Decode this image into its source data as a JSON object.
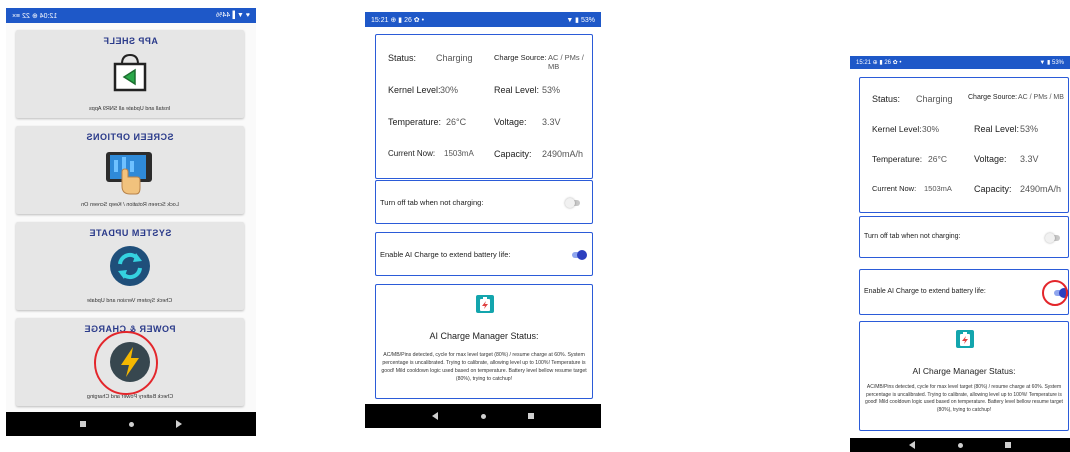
{
  "phone1": {
    "status_left": "♥ ▼ ▌44%",
    "status_right": "12:04 ⊕ 22 ≡×",
    "menu": [
      {
        "title": "APP SHELF",
        "subtitle": "Install and Update all SNR9 Apps",
        "icon": "app-shelf-bag-icon"
      },
      {
        "title": "SCREEN OPTIONS",
        "subtitle": "Lock Screen Rotation / Keep Screen On",
        "icon": "tablet-touch-icon"
      },
      {
        "title": "SYSTEM UPDATE",
        "subtitle": "Check System Version and Update",
        "icon": "refresh-circle-icon"
      },
      {
        "title": "POWER & CHARGE",
        "subtitle": "Check Battery Power and Charging",
        "icon": "lightning-circle-icon"
      }
    ]
  },
  "phone2": {
    "status_left": "15:21 ⊕ ▮ 26 ✿ •",
    "status_right": "▼ ▮ 53%",
    "stats": {
      "status_label": "Status:",
      "status_value": "Charging",
      "source_label": "Charge Source:",
      "source_value": "AC / PMs / MB",
      "kernel_label": "Kernel Level:",
      "kernel_value": "30%",
      "real_label": "Real Level:",
      "real_value": "53%",
      "temp_label": "Temperature:",
      "temp_value": "26°C",
      "voltage_label": "Voltage:",
      "voltage_value": "3.3V",
      "current_label": "Current Now:",
      "current_value": "1503mA",
      "capacity_label": "Capacity:",
      "capacity_value": "2490mA/h"
    },
    "turn_off_label": "Turn off tab when not charging:",
    "ai_label": "Enable AI Charge to extend battery life:",
    "manager_title": "AI Charge Manager Status:",
    "manager_desc": "AC/MB/Pins detected, cycle for max level target (80%) / resume charge at 60%. System percentage is uncalibrated. Trying to calibrate, allowing level up to 100%! Temperature is good! Mild cooldown logic used based on temperature. Battery level bellow resume target (80%), trying to catchup!"
  },
  "phone3": {
    "status_left": "15:21 ⊕ ▮ 26 ✿ •",
    "status_right": "▼ ▮ 53%",
    "stats": {
      "status_label": "Status:",
      "status_value": "Charging",
      "source_label": "Charge Source:",
      "source_value": "AC / PMs / MB",
      "kernel_label": "Kernel Level:",
      "kernel_value": "30%",
      "real_label": "Real Level:",
      "real_value": "53%",
      "temp_label": "Temperature:",
      "temp_value": "26°C",
      "voltage_label": "Voltage:",
      "voltage_value": "3.3V",
      "current_label": "Current Now:",
      "current_value": "1503mA",
      "capacity_label": "Capacity:",
      "capacity_value": "2490mA/h"
    },
    "turn_off_label": "Turn off tab when not charging:",
    "ai_label": "Enable AI Charge to extend battery life:",
    "manager_title": "AI Charge Manager Status:",
    "manager_desc": "AC/MB/Pins detected, cycle for max level target (80%) / resume charge at 60%. System percentage is uncalibrated. Trying to calibrate, allowing level up to 100%! Temperature is good! Mild cooldown logic used based on temperature. Battery level bellow resume target (80%), trying to catchup!"
  },
  "colors": {
    "statusbar": "#1e58c8",
    "card_border": "#2b5bd8",
    "highlight": "#e3262b",
    "toggle_on": "#2c3fbf"
  }
}
